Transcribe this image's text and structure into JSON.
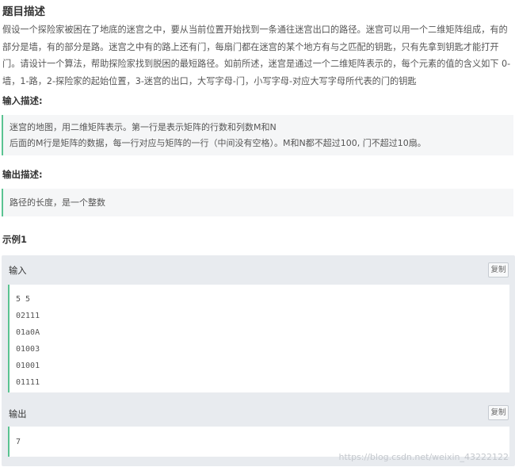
{
  "problem": {
    "title": "题目描述",
    "description": "假设一个探险家被困在了地底的迷宫之中，要从当前位置开始找到一条通往迷宫出口的路径。迷宫可以用一个二维矩阵组成，有的部分是墙，有的部分是路。迷宫之中有的路上还有门，每扇门都在迷宫的某个地方有与之匹配的钥匙，只有先拿到钥匙才能打开门。请设计一个算法，帮助探险家找到脱困的最短路径。如前所述，迷宫是通过一个二维矩阵表示的，每个元素的值的含义如下 0-墙，1-路，2-探险家的起始位置，3-迷宫的出口，大写字母-门，小写字母-对应大写字母所代表的门的钥匙"
  },
  "input_section": {
    "heading": "输入描述:",
    "lines": [
      "迷宫的地图，用二维矩阵表示。第一行是表示矩阵的行数和列数M和N",
      "后面的M行是矩阵的数据，每一行对应与矩阵的一行（中间没有空格）。M和N都不超过100, 门不超过10扇。"
    ]
  },
  "output_section": {
    "heading": "输出描述:",
    "lines": [
      "路径的长度，是一个整数"
    ]
  },
  "example": {
    "heading": "示例1",
    "input_label": "输入",
    "output_label": "输出",
    "copy_label": "复制",
    "input_lines": [
      "5 5",
      "02111",
      "01a0A",
      "01003",
      "01001",
      "01111"
    ],
    "output_lines": [
      "7"
    ]
  },
  "watermark": "https://blog.csdn.net/weixin_43222122",
  "colors": {
    "accent": "#5ac391",
    "panel": "#e8ebef",
    "quote_bg": "#f5f6f7"
  }
}
